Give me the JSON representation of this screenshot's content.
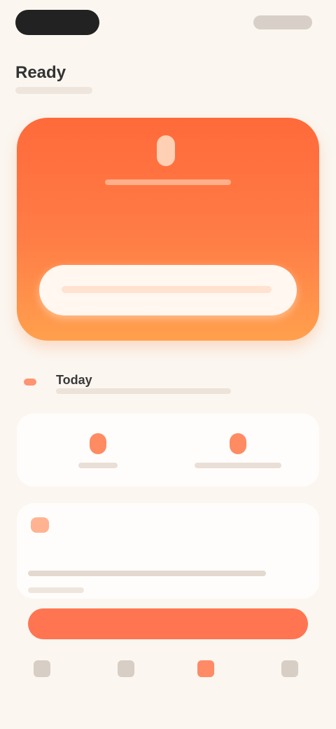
{
  "page": {
    "title": "Ready"
  },
  "hero": {
    "icon": "mic-icon"
  },
  "section": {
    "title": "Today"
  },
  "stats": [
    {
      "icon": "pin-icon"
    },
    {
      "icon": "pin-icon"
    }
  ],
  "tip": {
    "icon": "spark-icon"
  },
  "tabs": [
    {
      "icon": "home-icon"
    },
    {
      "icon": "calendar-icon"
    },
    {
      "icon": "mic-icon"
    },
    {
      "icon": "profile-icon"
    }
  ],
  "colors": {
    "accent": "#ff7552",
    "hero_top": "#ff6a3a",
    "hero_bottom": "#ffa04d",
    "background": "#fbf6f0"
  }
}
